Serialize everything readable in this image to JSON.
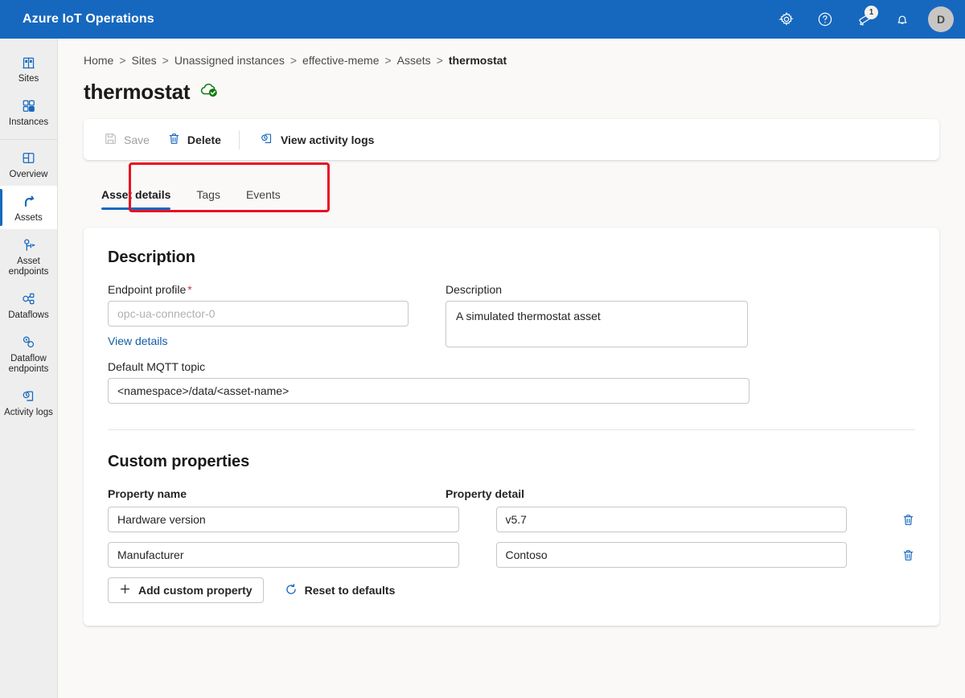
{
  "header": {
    "brand": "Azure IoT Operations",
    "icons": [
      {
        "name": "settings-icon",
        "label": "Settings"
      },
      {
        "name": "help-icon",
        "label": "Help"
      },
      {
        "name": "announcements-icon",
        "label": "Announcements",
        "badge": "1"
      },
      {
        "name": "notifications-bell-icon",
        "label": "Notifications"
      }
    ],
    "avatar_initial": "D",
    "accent_color": "#1668bf"
  },
  "sidebar": {
    "items": [
      {
        "label": "Sites",
        "icon": "sites-icon",
        "active": false
      },
      {
        "label": "Instances",
        "icon": "instances-icon",
        "active": false
      },
      {
        "label": "Overview",
        "icon": "overview-icon",
        "active": false
      },
      {
        "label": "Assets",
        "icon": "assets-icon",
        "active": true
      },
      {
        "label": "Asset endpoints",
        "icon": "asset-endpoints-icon",
        "active": false
      },
      {
        "label": "Dataflows",
        "icon": "dataflows-icon",
        "active": false
      },
      {
        "label": "Dataflow endpoints",
        "icon": "dataflow-endpoints-icon",
        "active": false
      },
      {
        "label": "Activity logs",
        "icon": "activity-logs-icon",
        "active": false
      }
    ]
  },
  "breadcrumb": {
    "items": [
      "Home",
      "Sites",
      "Unassigned instances",
      "effective-meme",
      "Assets"
    ],
    "current": "thermostat",
    "separator": ">"
  },
  "page": {
    "title": "thermostat",
    "status_icon": "cloud-connected-icon",
    "status_color": "#107c10"
  },
  "toolbar": {
    "save_label": "Save",
    "save_disabled": true,
    "delete_label": "Delete",
    "view_activity_logs_label": "View activity logs"
  },
  "tabs": [
    {
      "label": "Asset details",
      "active": true
    },
    {
      "label": "Tags",
      "active": false
    },
    {
      "label": "Events",
      "active": false
    }
  ],
  "highlight": {
    "color": "#e81123"
  },
  "description_section": {
    "heading": "Description",
    "endpoint_profile": {
      "label": "Endpoint profile",
      "required_marker": "*",
      "value": "opc-ua-connector-0",
      "disabled": true
    },
    "view_details_link": "View details",
    "description": {
      "label": "Description",
      "value": "A simulated thermostat asset"
    },
    "default_mqtt_topic": {
      "label": "Default MQTT topic",
      "value": "<namespace>/data/<asset-name>"
    }
  },
  "custom_properties": {
    "heading": "Custom properties",
    "col_name_header": "Property name",
    "col_detail_header": "Property detail",
    "rows": [
      {
        "name": "Hardware version",
        "detail": "v5.7"
      },
      {
        "name": "Manufacturer",
        "detail": "Contoso"
      }
    ],
    "add_label": "Add custom property",
    "reset_label": "Reset to defaults",
    "delete_icon": "trash-icon"
  }
}
